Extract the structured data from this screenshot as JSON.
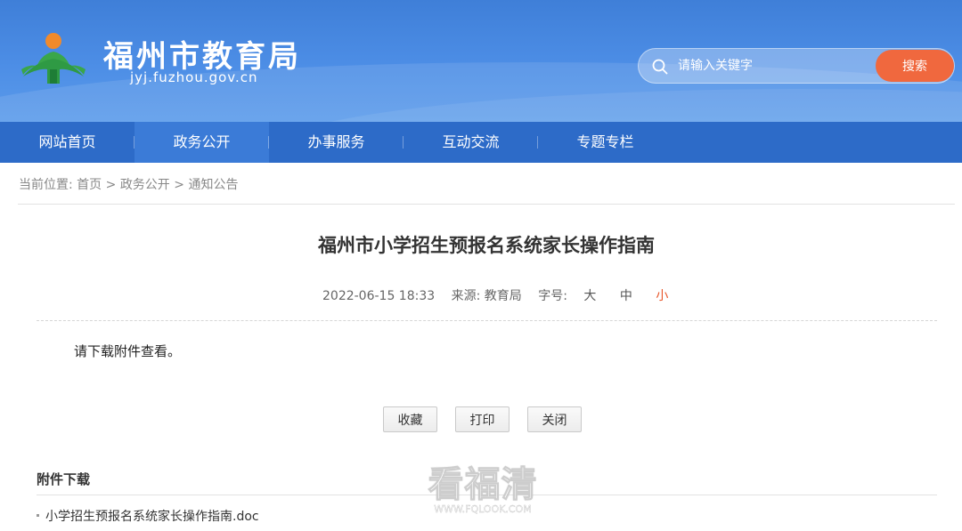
{
  "header": {
    "site_title": "福州市教育局",
    "site_domain": "jyj.fuzhou.gov.cn",
    "search": {
      "placeholder": "请输入关键字",
      "button_label": "搜索"
    },
    "colors": {
      "header_blue": "#4d8ee6",
      "nav_blue": "#2d6bc8",
      "search_orange": "#f0683e"
    }
  },
  "nav": {
    "items": [
      {
        "label": "网站首页"
      },
      {
        "label": "政务公开"
      },
      {
        "label": "办事服务"
      },
      {
        "label": "互动交流"
      },
      {
        "label": "专题专栏"
      }
    ],
    "active_index": 1
  },
  "breadcrumb": {
    "prefix": "当前位置:",
    "items": [
      "首页",
      "政务公开",
      "通知公告"
    ],
    "separator": ">"
  },
  "article": {
    "title": "福州市小学招生预报名系统家长操作指南",
    "datetime": "2022-06-15 18:33",
    "source": "来源: 教育局",
    "font_size_label": "字号:",
    "font_sizes": [
      "大",
      "中",
      "小"
    ],
    "selected_font_size": "小",
    "body": "请下载附件查看。"
  },
  "actions": {
    "favorite": "收藏",
    "print": "打印",
    "close": "关闭"
  },
  "attachments": {
    "title": "附件下载",
    "items": [
      "小学招生预报名系统家长操作指南.doc"
    ]
  },
  "watermark": {
    "main": "看福清",
    "sub": "WWW.FQLOOK.COM"
  }
}
